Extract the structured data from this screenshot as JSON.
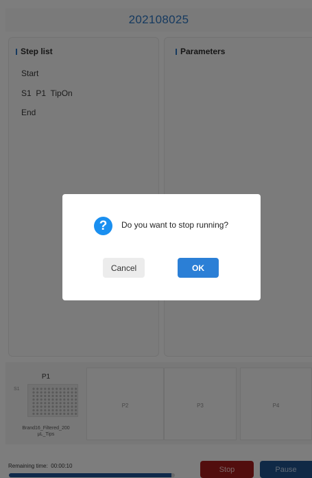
{
  "header": {
    "title": "202108025"
  },
  "step_panel": {
    "heading": "Step list",
    "steps": [
      "Start",
      "S1  P1  TipOn",
      "End"
    ]
  },
  "param_panel": {
    "heading": "Parameters"
  },
  "deck": {
    "slot1": {
      "name": "P1",
      "position": "S1",
      "labware": "Brand16_Filtered_200\nμL_Tips"
    },
    "slot2": {
      "label": "P2"
    },
    "slot3": {
      "label": "P3"
    },
    "slot4": {
      "label": "P4"
    }
  },
  "footer": {
    "remaining_label": "Remaining time:",
    "remaining_value": "00:00:10",
    "progress": 0.98,
    "stop_label": "Stop",
    "pause_label": "Pause"
  },
  "dialog": {
    "icon": "question-icon",
    "icon_glyph": "?",
    "message": "Do you want to stop running?",
    "cancel_label": "Cancel",
    "ok_label": "OK"
  },
  "colors": {
    "accent": "#2a6fb6",
    "stop": "#9c1c1c",
    "pause": "#1f4e84",
    "ok": "#2b7fd6",
    "question": "#1a8ff0"
  }
}
